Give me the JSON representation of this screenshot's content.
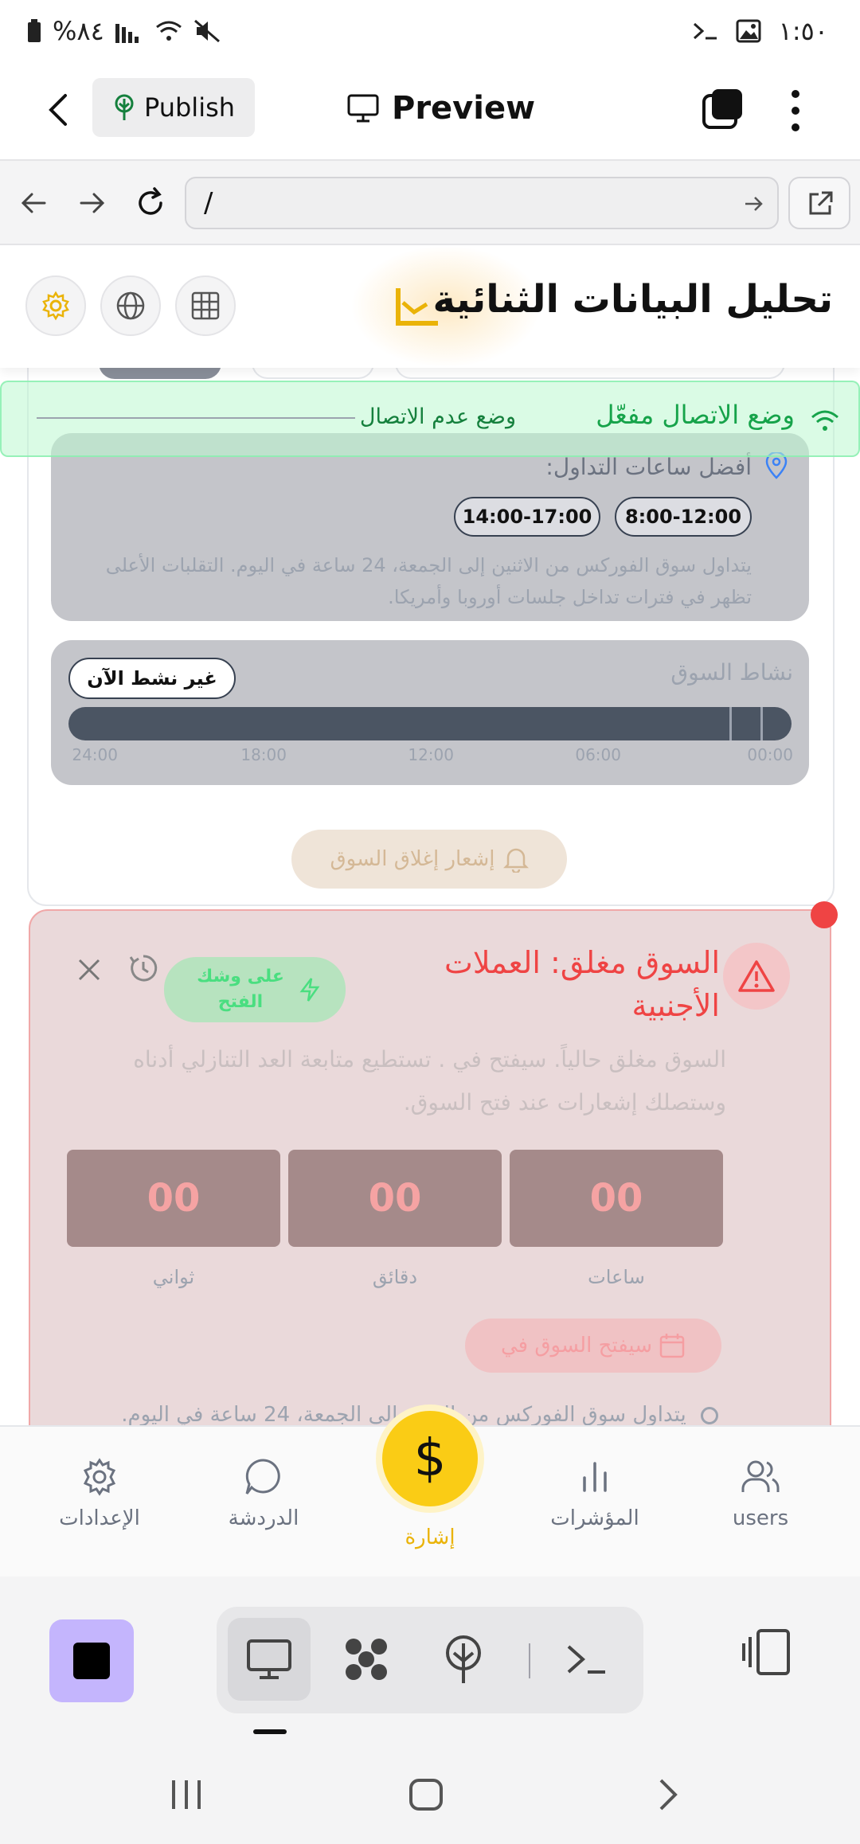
{
  "status_bar": {
    "time": "١:٥٠",
    "battery": "%٨٤"
  },
  "header": {
    "publish_label": "Publish",
    "preview_label": "Preview"
  },
  "url_bar": {
    "url": "/"
  },
  "page": {
    "title": "تحليل البيانات الثنائية"
  },
  "offline_banner": {
    "main": "وضع الاتصال مفعّل",
    "sub": "وضع عدم الاتصال"
  },
  "trading_hours": {
    "title": "أفضل ساعات التداول:",
    "slots": [
      "8:00-12:00",
      "14:00-17:00"
    ],
    "description": "يتداول سوق الفوركس من الاثنين إلى الجمعة، 24 ساعة في اليوم. التقلبات الأعلى تظهر في فترات تداخل جلسات أوروبا وأمريكا."
  },
  "market_activity": {
    "title": "نشاط السوق",
    "status": "غير نشط الآن",
    "ticks": [
      "00:00",
      "06:00",
      "12:00",
      "18:00",
      "24:00"
    ]
  },
  "notify_button": "إشعار إغلاق السوق",
  "market_closed": {
    "title": "السوق مغلق: العملات الأجنبية",
    "badge": "على وشك الفتح",
    "description": "السوق مغلق حالياً. سيفتح في . تستطيع متابعة العد التنازلي أدناه وستصلك إشعارات عند فتح السوق.",
    "countdown": [
      {
        "value": "00",
        "label": "ساعات"
      },
      {
        "value": "00",
        "label": "دقائق"
      },
      {
        "value": "00",
        "label": "ثواني"
      }
    ],
    "opens_label": "سيفتح السوق في",
    "footer": "يتداول سوق الفوركس من الاثنين إلى الجمعة، 24 ساعة في اليوم."
  },
  "bottom_nav": {
    "items": [
      {
        "label": "users",
        "icon": "users-icon"
      },
      {
        "label": "المؤشرات",
        "icon": "bar-chart-icon"
      },
      {
        "label": "إشارة",
        "icon": "dollar-icon"
      },
      {
        "label": "الدردشة",
        "icon": "chat-icon"
      },
      {
        "label": "الإعدادات",
        "icon": "gear-icon"
      }
    ],
    "active": "إشارة",
    "signal_symbol": "$"
  },
  "colors": {
    "accent": "#facc15",
    "danger": "#ef4444",
    "success": "#16a34a",
    "stop": "#c4b5fd"
  }
}
